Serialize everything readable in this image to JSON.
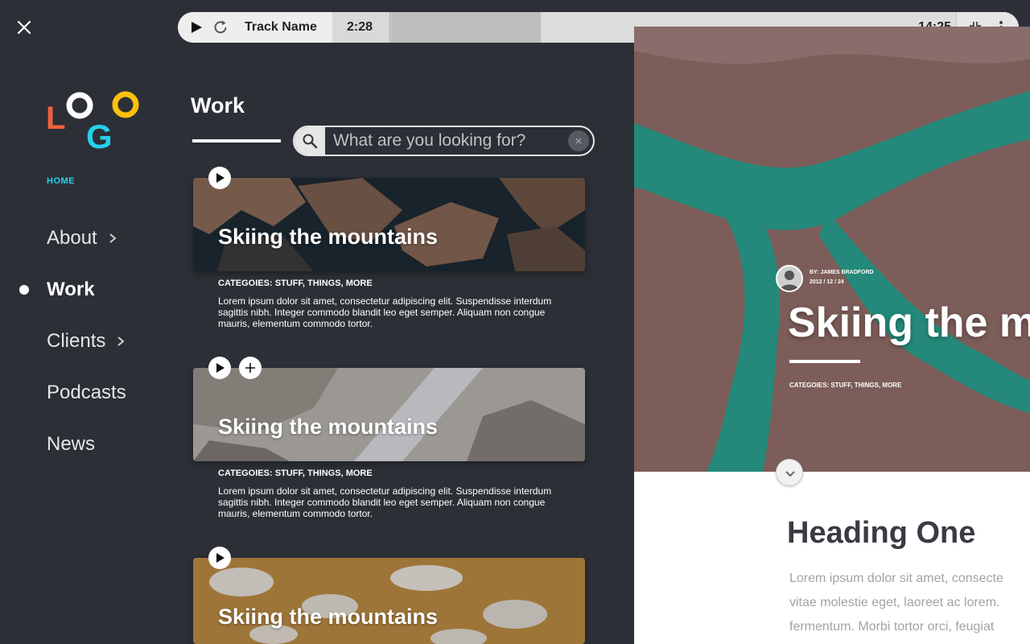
{
  "player": {
    "track_name": "Track Name",
    "elapsed": "2:28",
    "duration": "14:25",
    "progress_fraction": 0.24
  },
  "logo": {
    "letters": [
      "L",
      "O",
      "G",
      "O"
    ],
    "colors": [
      "#f2613a",
      "#ffffff",
      "#25d0ee",
      "#fec10d"
    ]
  },
  "nav": {
    "home": "HOME",
    "items": [
      {
        "label": "About",
        "has_submenu": true
      },
      {
        "label": "Work",
        "active": true
      },
      {
        "label": "Clients",
        "has_submenu": true
      },
      {
        "label": "Podcasts"
      },
      {
        "label": "News"
      }
    ]
  },
  "work": {
    "title": "Work",
    "search_placeholder": "What are you looking for?"
  },
  "cards": [
    {
      "title": "Skiing the mountains",
      "categories": "CATEGOIES: STUFF, THINGS, MORE",
      "body": "Lorem ipsum dolor sit amet, consectetur adipiscing elit. Suspendisse interdum sagittis nibh. Integer commodo blandit leo eget semper. Aliquam non congue mauris, elementum commodo tortor."
    },
    {
      "title": "Skiing the mountains",
      "categories": "CATEGOIES: STUFF, THINGS, MORE",
      "body": "Lorem ipsum dolor sit amet, consectetur adipiscing elit. Suspendisse interdum sagittis nibh. Integer commodo blandit leo eget semper. Aliquam non congue mauris, elementum commodo tortor."
    },
    {
      "title": "Skiing the mountains"
    }
  ],
  "article": {
    "author": "BY:  JAMES BRADFORD",
    "date": "2012 / 12 / 24",
    "title": "Skiing the mountains",
    "categories": "CATEGOIES: STUFF, THINGS, MORE",
    "heading": "Heading One",
    "body_lines": [
      "Lorem ipsum dolor sit amet, consecte",
      "vitae molestie eget, laoreet ac lorem.",
      "fermentum. Morbi tortor orci, feugiat"
    ]
  },
  "colors": {
    "accent": "#25d0ee",
    "background": "#2c3036"
  }
}
